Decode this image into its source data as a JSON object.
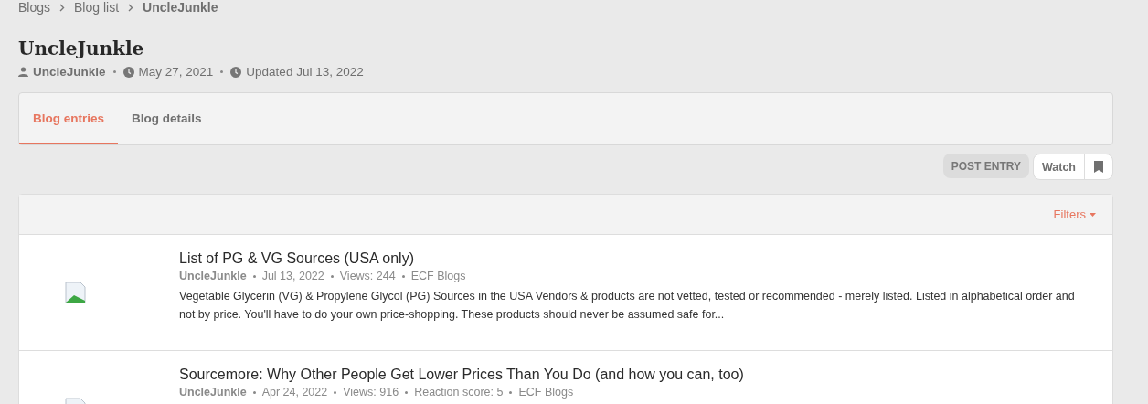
{
  "breadcrumb": [
    "Blogs",
    "Blog list",
    "UncleJunkle"
  ],
  "title": "UncleJunkle",
  "byline": {
    "author": "UncleJunkle",
    "created": "May 27, 2021",
    "updated": "Updated Jul 13, 2022"
  },
  "tabs": [
    {
      "label": "Blog entries",
      "selected": true
    },
    {
      "label": "Blog details",
      "selected": false
    }
  ],
  "actions": {
    "post": "POST ENTRY",
    "watch": "Watch"
  },
  "filters": "Filters",
  "entries": [
    {
      "title": "List of PG & VG Sources (USA only)",
      "author": "UncleJunkle",
      "meta": [
        "Jul 13, 2022",
        "Views: 244",
        "ECF Blogs"
      ],
      "snippet": "Vegetable Glycerin (VG) & Propylene Glycol (PG) Sources in the USA Vendors & products are not vetted, tested or recommended - merely listed. Listed in alphabetical order and not by price. You'll have to do your own price-shopping. These products should never be assumed safe for..."
    },
    {
      "title": "Sourcemore: Why Other People Get Lower Prices Than You Do (and how you can, too)",
      "author": "UncleJunkle",
      "meta": [
        "Apr 24, 2022",
        "Views: 916",
        "Reaction score: 5",
        "ECF Blogs"
      ]
    }
  ]
}
